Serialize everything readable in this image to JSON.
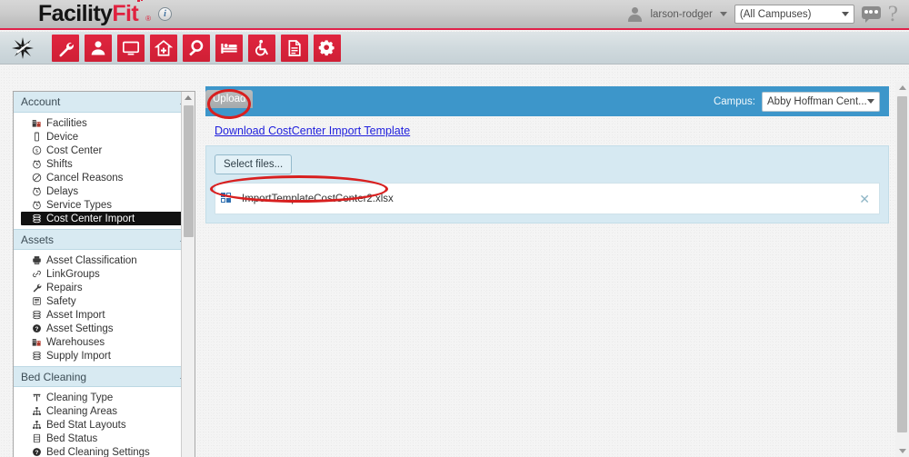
{
  "app": {
    "logo_primary": "Facility",
    "logo_accent": "Fit",
    "logo_reg": "®",
    "info_icon": "i"
  },
  "header": {
    "username": "larson-rodger",
    "user_icon": "avatar-icon",
    "user_caret": "chevron-down-icon",
    "campus_filter_value": "(All Campuses)",
    "campus_filter_caret": "chevron-down-icon",
    "chat_icon": "chat-bubble-icon",
    "help_icon": "?"
  },
  "toolbar": {
    "star_icon": "sparkle-icon",
    "buttons": [
      {
        "name": "wrench-icon",
        "label": "Maintenance"
      },
      {
        "name": "person-icon",
        "label": "Staff"
      },
      {
        "name": "monitor-icon",
        "label": "Displays"
      },
      {
        "name": "home-plus-icon",
        "label": "Facility"
      },
      {
        "name": "magnifier-icon",
        "label": "Search"
      },
      {
        "name": "bed-icon",
        "label": "Beds"
      },
      {
        "name": "wheelchair-icon",
        "label": "Transport"
      },
      {
        "name": "document-icon",
        "label": "Reports"
      },
      {
        "name": "gears-icon",
        "label": "Settings"
      }
    ]
  },
  "sidebar": {
    "sections": [
      {
        "title": "Account",
        "collapse_icon": "chevron-up-icon",
        "items": [
          {
            "label": "Facilities",
            "icon": "building-icon",
            "selected": false
          },
          {
            "label": "Device",
            "icon": "device-icon",
            "selected": false
          },
          {
            "label": "Cost Center",
            "icon": "dollar-icon",
            "selected": false
          },
          {
            "label": "Shifts",
            "icon": "clock-icon",
            "selected": false
          },
          {
            "label": "Cancel Reasons",
            "icon": "no-entry-icon",
            "selected": false
          },
          {
            "label": "Delays",
            "icon": "clock-icon",
            "selected": false
          },
          {
            "label": "Service Types",
            "icon": "clock-icon",
            "selected": false
          },
          {
            "label": "Cost Center Import",
            "icon": "stack-icon",
            "selected": true
          }
        ]
      },
      {
        "title": "Assets",
        "collapse_icon": "chevron-up-icon",
        "items": [
          {
            "label": "Asset Classification",
            "icon": "printer-icon",
            "selected": false
          },
          {
            "label": "LinkGroups",
            "icon": "link-icon",
            "selected": false
          },
          {
            "label": "Repairs",
            "icon": "wrench-icon",
            "selected": false
          },
          {
            "label": "Safety",
            "icon": "safety-icon",
            "selected": false
          },
          {
            "label": "Asset Import",
            "icon": "stack-icon",
            "selected": false
          },
          {
            "label": "Asset Settings",
            "icon": "question-icon",
            "selected": false
          },
          {
            "label": "Warehouses",
            "icon": "building-icon",
            "selected": false
          },
          {
            "label": "Supply Import",
            "icon": "stack-icon",
            "selected": false
          }
        ]
      },
      {
        "title": "Bed Cleaning",
        "collapse_icon": "chevron-up-icon",
        "items": [
          {
            "label": "Cleaning Type",
            "icon": "mop-icon",
            "selected": false
          },
          {
            "label": "Cleaning Areas",
            "icon": "hierarchy-icon",
            "selected": false
          },
          {
            "label": "Bed Stat Layouts",
            "icon": "hierarchy-icon",
            "selected": false
          },
          {
            "label": "Bed Status",
            "icon": "list-icon",
            "selected": false
          },
          {
            "label": "Bed Cleaning Settings",
            "icon": "question-icon",
            "selected": false
          }
        ]
      }
    ],
    "scroll_up_icon": "chevron-up-icon"
  },
  "main": {
    "upload_tab_label": "Upload",
    "campus_label": "Campus:",
    "campus_value": "Abby Hoffman Cent...",
    "campus_caret": "chevron-down-icon",
    "download_link": "Download CostCenter Import Template",
    "select_files_label": "Select files...",
    "files": [
      {
        "name": "ImportTemplateCostCenter2.xlsx",
        "icon": "spreadsheet-icon",
        "remove_label": "✕"
      }
    ]
  },
  "page_scroll": {
    "up_icon": "chevron-up-icon",
    "down_icon": "chevron-down-icon"
  },
  "annotations": [
    {
      "name": "upload-tab-highlight",
      "shape": "ellipse",
      "color": "#d81f1f"
    },
    {
      "name": "file-row-highlight",
      "shape": "ellipse",
      "color": "#d81f1f"
    }
  ],
  "colors": {
    "brand_red": "#e0223f",
    "header_blue": "#3d96ca",
    "panel_blue": "#d6e9f2",
    "section_blue": "#d8eaf2",
    "link_blue": "#2020dd",
    "annotation_red": "#d81f1f"
  }
}
